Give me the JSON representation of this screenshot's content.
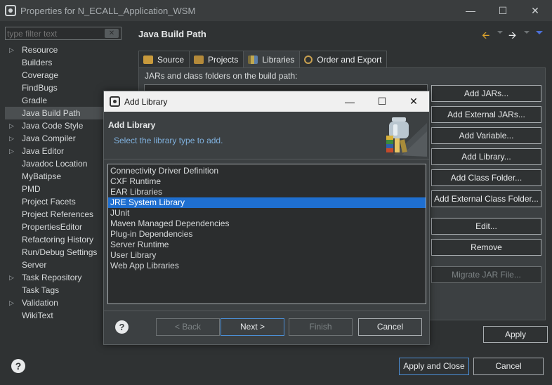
{
  "window": {
    "title": "Properties for N_ECALL_Application_WSM"
  },
  "filter": {
    "placeholder": "type filter text"
  },
  "tree": [
    {
      "label": "Resource",
      "expandable": true
    },
    {
      "label": "Builders",
      "expandable": false
    },
    {
      "label": "Coverage",
      "expandable": false
    },
    {
      "label": "FindBugs",
      "expandable": false
    },
    {
      "label": "Gradle",
      "expandable": false
    },
    {
      "label": "Java Build Path",
      "expandable": false,
      "selected": true
    },
    {
      "label": "Java Code Style",
      "expandable": true
    },
    {
      "label": "Java Compiler",
      "expandable": true
    },
    {
      "label": "Java Editor",
      "expandable": true
    },
    {
      "label": "Javadoc Location",
      "expandable": false
    },
    {
      "label": "MyBatipse",
      "expandable": false
    },
    {
      "label": "PMD",
      "expandable": false
    },
    {
      "label": "Project Facets",
      "expandable": false
    },
    {
      "label": "Project References",
      "expandable": false
    },
    {
      "label": "PropertiesEditor",
      "expandable": false
    },
    {
      "label": "Refactoring History",
      "expandable": false
    },
    {
      "label": "Run/Debug Settings",
      "expandable": false
    },
    {
      "label": "Server",
      "expandable": false
    },
    {
      "label": "Task Repository",
      "expandable": true
    },
    {
      "label": "Task Tags",
      "expandable": false
    },
    {
      "label": "Validation",
      "expandable": true
    },
    {
      "label": "WikiText",
      "expandable": false
    }
  ],
  "page": {
    "title": "Java Build Path",
    "tabs": [
      "Source",
      "Projects",
      "Libraries",
      "Order and Export"
    ],
    "active_tab": "Libraries",
    "panel_label": "JARs and class folders on the build path:",
    "buttons": {
      "add_jars": "Add JARs...",
      "add_external_jars": "Add External JARs...",
      "add_variable": "Add Variable...",
      "add_library": "Add Library...",
      "add_class_folder": "Add Class Folder...",
      "add_external_class_folder": "Add External Class Folder...",
      "edit": "Edit...",
      "remove": "Remove",
      "migrate_jar": "Migrate JAR File...",
      "apply": "Apply"
    }
  },
  "footer": {
    "apply_and_close": "Apply and Close",
    "cancel": "Cancel"
  },
  "dialog": {
    "title": "Add Library",
    "header_title": "Add Library",
    "header_desc": "Select the library type to add.",
    "libraries": [
      "Connectivity Driver Definition",
      "CXF Runtime",
      "EAR Libraries",
      "JRE System Library",
      "JUnit",
      "Maven Managed Dependencies",
      "Plug-in Dependencies",
      "Server Runtime",
      "User Library",
      "Web App Libraries"
    ],
    "selected_library": "JRE System Library",
    "buttons": {
      "back": "< Back",
      "next": "Next >",
      "finish": "Finish",
      "cancel": "Cancel"
    }
  },
  "colors": {
    "selection": "#1f6fd0",
    "primary_border": "#4c8fd6",
    "link_text": "#7fb0dd"
  }
}
